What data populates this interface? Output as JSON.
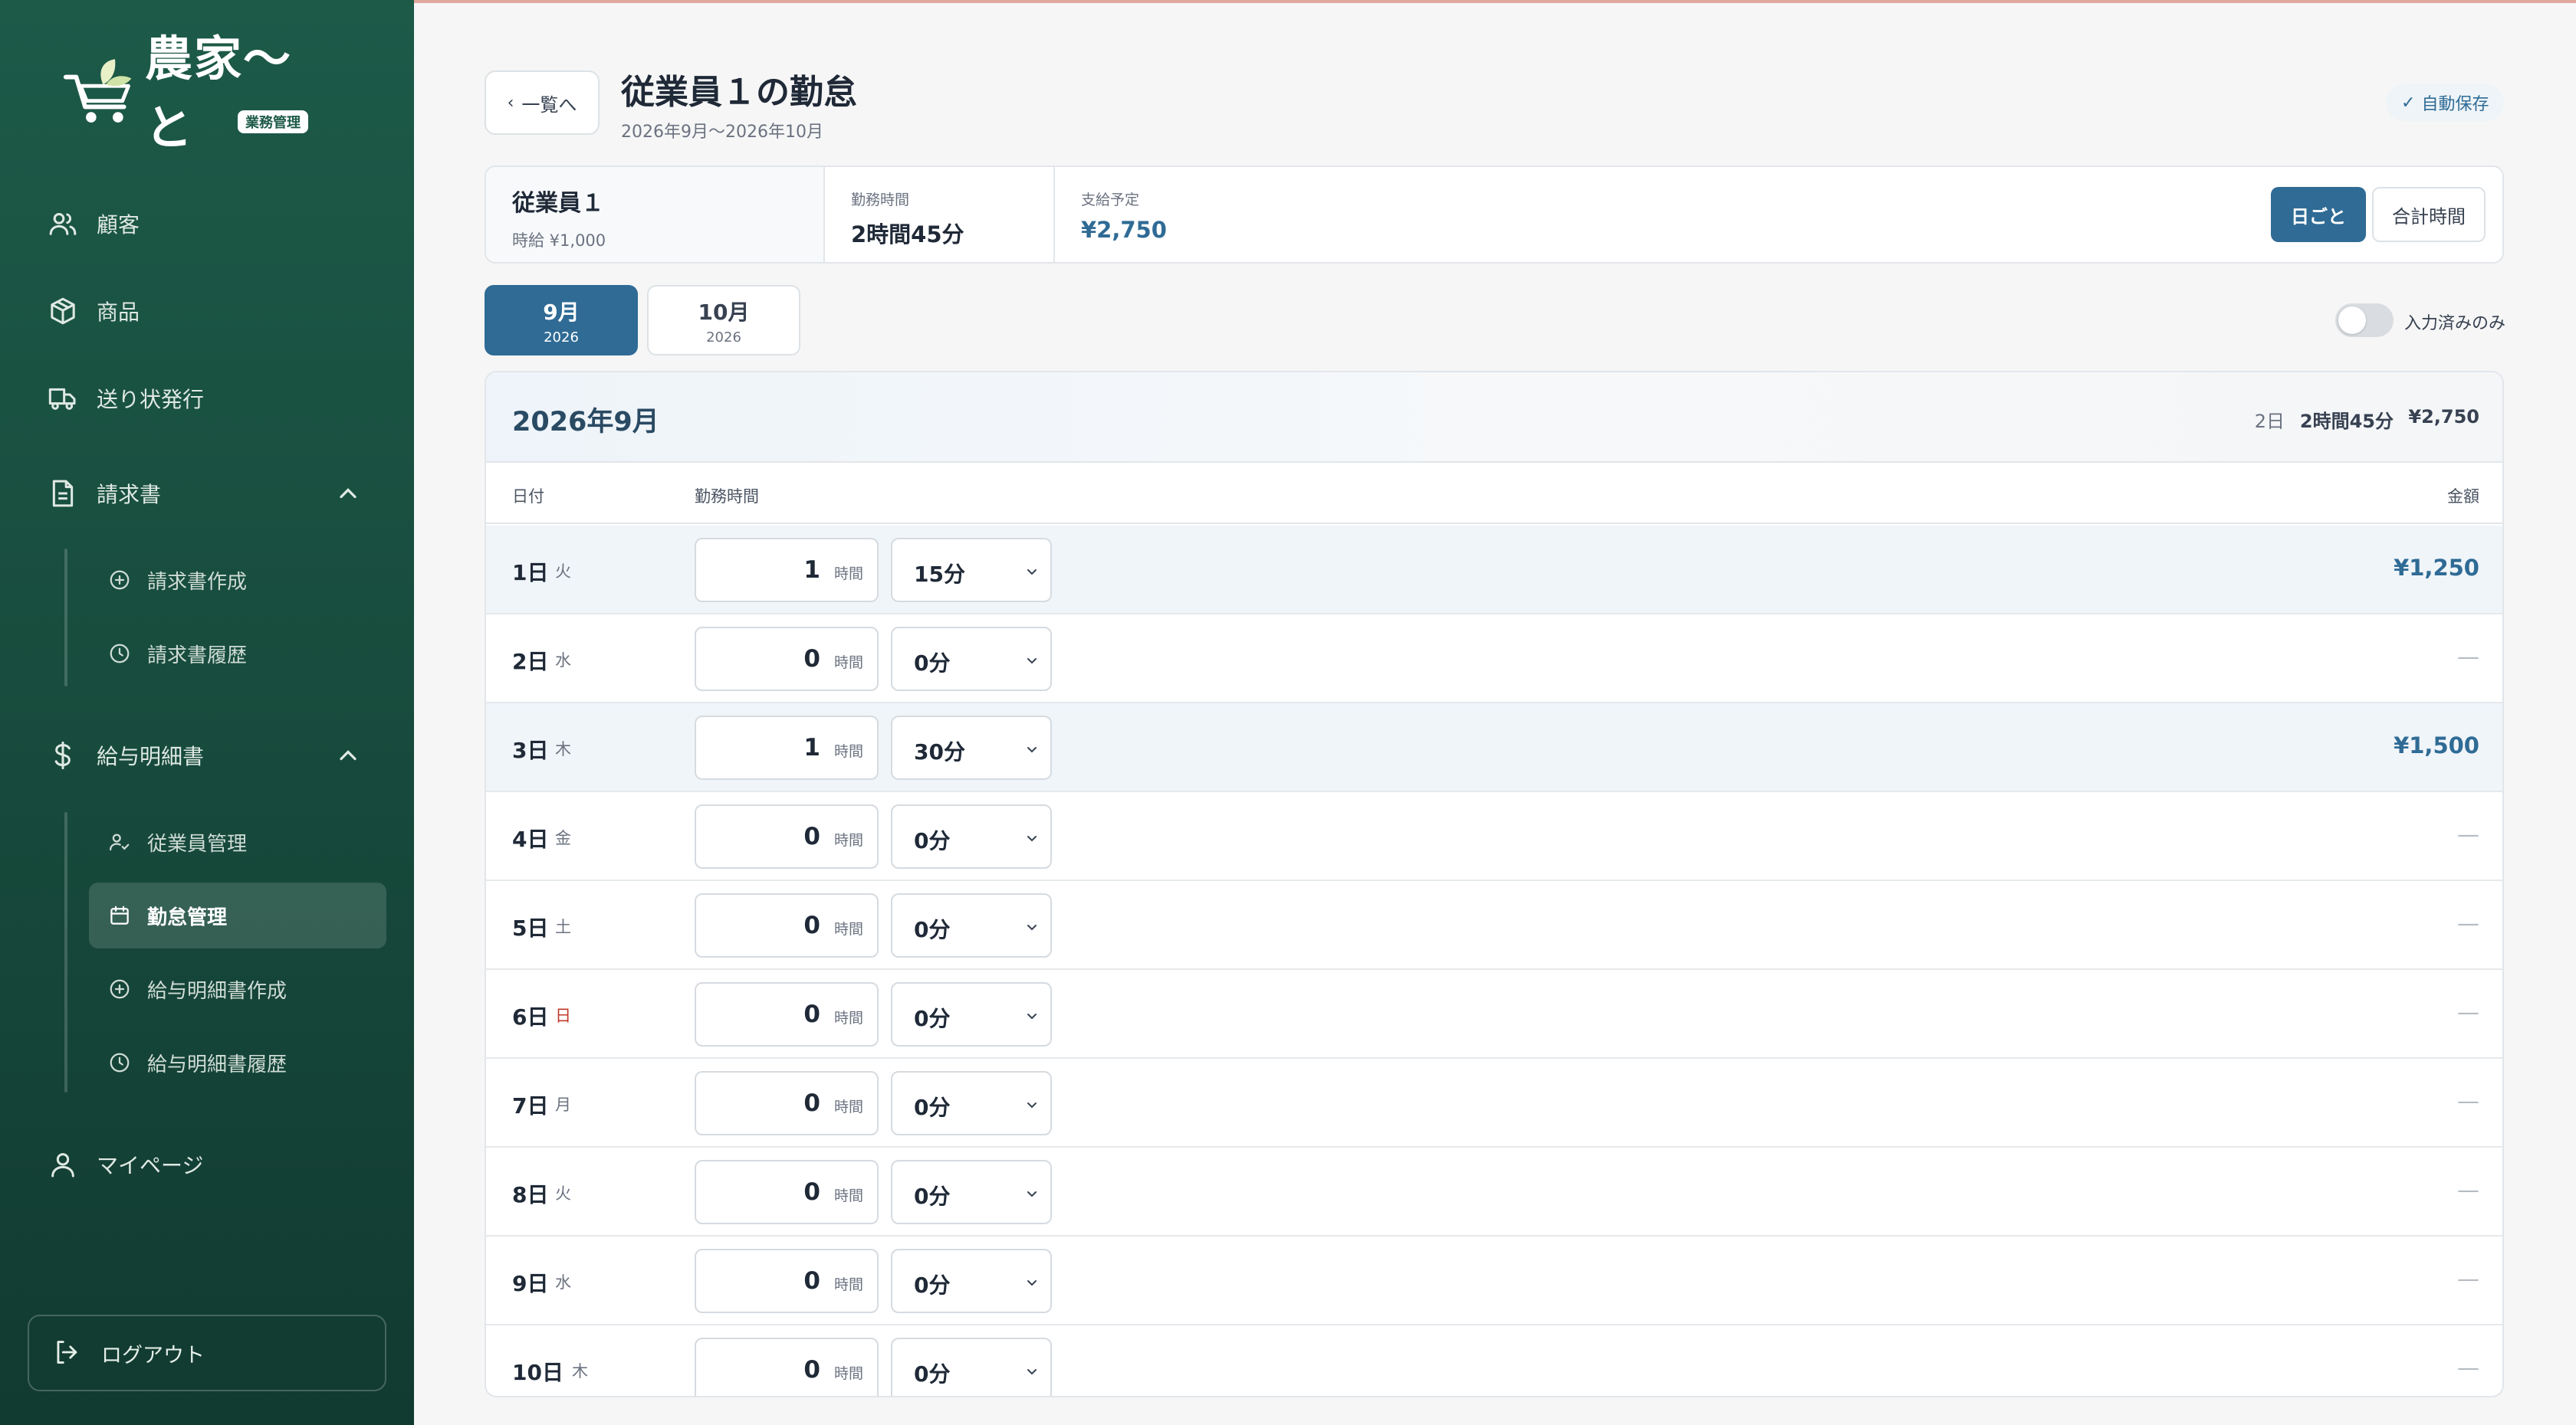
{
  "app": {
    "logo_text": "農家〜と",
    "logo_badge": "業務管理"
  },
  "sidebar": {
    "customers": "顧客",
    "products": "商品",
    "shipping": "送り状発行",
    "invoice": {
      "label": "請求書",
      "create": "請求書作成",
      "history": "請求書履歴"
    },
    "payroll": {
      "label": "給与明細書",
      "employees": "従業員管理",
      "attendance": "勤怠管理",
      "create": "給与明細書作成",
      "history": "給与明細書履歴"
    },
    "mypage": "マイページ",
    "logout": "ログアウト"
  },
  "header": {
    "back_label": "一覧へ",
    "title": "従業員１の勤怠",
    "period": "2026年9月〜2026年10月",
    "autosave": "自動保存"
  },
  "summary": {
    "employee_name": "従業員１",
    "hourly_rate": "時給 ¥1,000",
    "work_time_label": "勤務時間",
    "work_time_value": "2時間45分",
    "payment_label": "支給予定",
    "payment_value": "¥2,750",
    "view_daily": "日ごと",
    "view_total": "合計時間"
  },
  "months": [
    {
      "month": "9月",
      "year": "2026"
    },
    {
      "month": "10月",
      "year": "2026"
    }
  ],
  "filter": {
    "label": "入力済みのみ"
  },
  "table": {
    "month_title": "2026年9月",
    "stat_days": "2日",
    "stat_time": "2時間45分",
    "stat_amount": "¥2,750",
    "col_date": "日付",
    "col_work": "勤務時間",
    "col_amount": "金額",
    "hour_unit": "時間",
    "rows": [
      {
        "day": "1日",
        "weekday": "火",
        "hours": "1",
        "minutes": "15分",
        "amount": "¥1,250"
      },
      {
        "day": "2日",
        "weekday": "水",
        "hours": "0",
        "minutes": "0分",
        "amount": "—"
      },
      {
        "day": "3日",
        "weekday": "木",
        "hours": "1",
        "minutes": "30分",
        "amount": "¥1,500"
      },
      {
        "day": "4日",
        "weekday": "金",
        "hours": "0",
        "minutes": "0分",
        "amount": "—"
      },
      {
        "day": "5日",
        "weekday": "土",
        "hours": "0",
        "minutes": "0分",
        "amount": "—"
      },
      {
        "day": "6日",
        "weekday": "日",
        "hours": "0",
        "minutes": "0分",
        "amount": "—"
      },
      {
        "day": "7日",
        "weekday": "月",
        "hours": "0",
        "minutes": "0分",
        "amount": "—"
      },
      {
        "day": "8日",
        "weekday": "火",
        "hours": "0",
        "minutes": "0分",
        "amount": "—"
      },
      {
        "day": "9日",
        "weekday": "水",
        "hours": "0",
        "minutes": "0分",
        "amount": "—"
      },
      {
        "day": "10日",
        "weekday": "木",
        "hours": "0",
        "minutes": "0分",
        "amount": "—"
      }
    ]
  },
  "colors": {
    "sidebar": "#1d5a48",
    "accent": "#2f6b95",
    "sunday": "#c0392b"
  }
}
